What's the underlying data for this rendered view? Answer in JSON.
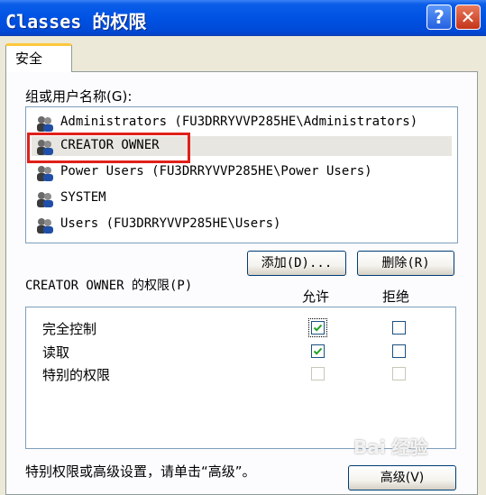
{
  "window": {
    "title": "Classes 的权限",
    "help_label": "?",
    "close_label": "✕"
  },
  "tabs": [
    {
      "label": "安全"
    }
  ],
  "principals": {
    "label": "组或用户名称(G):",
    "items": [
      {
        "name": "Administrators (FU3DRRYVVP285HE\\Administrators)",
        "icon": "user-group-icon",
        "selected": false
      },
      {
        "name": "CREATOR OWNER",
        "icon": "user-group-icon",
        "selected": true
      },
      {
        "name": "Power Users (FU3DRRYVVP285HE\\Power Users)",
        "icon": "user-group-icon",
        "selected": false
      },
      {
        "name": "SYSTEM",
        "icon": "user-group-icon",
        "selected": false
      },
      {
        "name": "Users (FU3DRRYVVP285HE\\Users)",
        "icon": "user-group-icon",
        "selected": false
      }
    ],
    "add_button": "添加(D)...",
    "remove_button": "删除(R)"
  },
  "permissions": {
    "label": "CREATOR OWNER 的权限(P)",
    "allow_header": "允许",
    "deny_header": "拒绝",
    "rows": [
      {
        "name": "完全控制",
        "allow": "checked",
        "deny": "unchecked"
      },
      {
        "name": "读取",
        "allow": "checked",
        "deny": "unchecked"
      },
      {
        "name": "特别的权限",
        "allow": "disabled",
        "deny": "disabled"
      }
    ]
  },
  "advanced": {
    "hint": "特别权限或高级设置，请单击“高级”。",
    "button": "高级(V)"
  },
  "watermark": "Bai 经验",
  "colors": {
    "titlebar": "#0052E3",
    "highlight": "#E0201A",
    "tab_accent": "#FFC83C",
    "check": "#21A121"
  }
}
